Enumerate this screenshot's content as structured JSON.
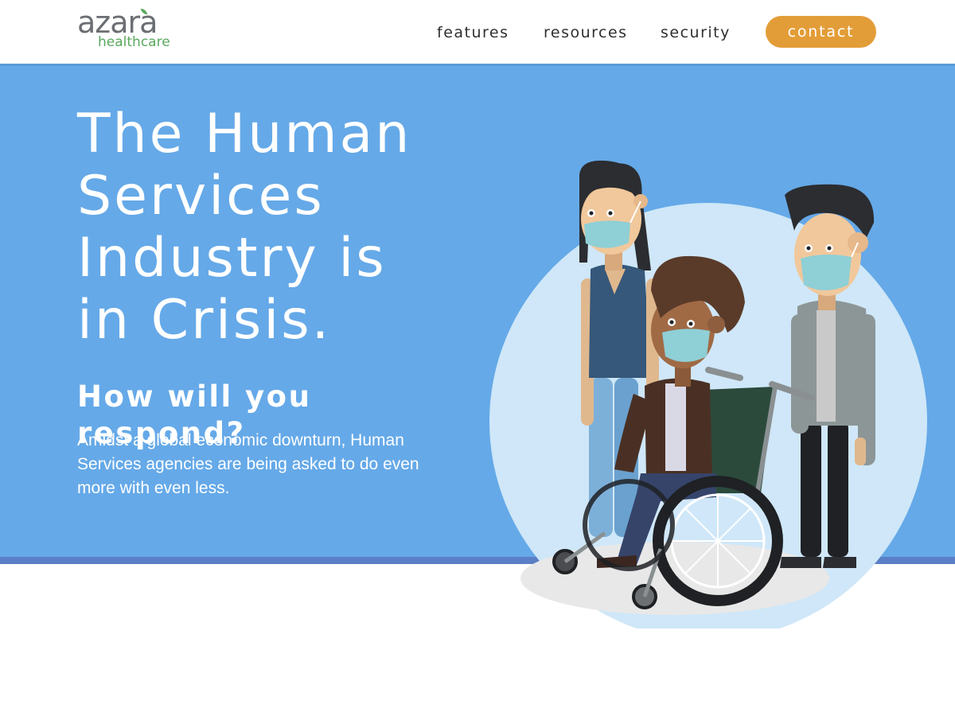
{
  "brand": {
    "name_main": "azara",
    "name_sub": "healthcare"
  },
  "nav": {
    "items": [
      {
        "label": "features"
      },
      {
        "label": "resources"
      },
      {
        "label": "security"
      }
    ],
    "contact_label": "contact"
  },
  "hero": {
    "headline_lines": [
      "The Human",
      "Services",
      "Industry is",
      "in Crisis."
    ],
    "subheadline": "How will you respond?",
    "body": "Amidst a global economic downturn, Human Services agencies are being asked to do even more with even less."
  },
  "colors": {
    "hero_background": "#65a9e8",
    "hero_bottom_bar": "#5b7fc6",
    "contact_button": "#e39d38",
    "brand_green": "#5aa85e",
    "brand_gray": "#6b6e72",
    "circle_backdrop": "#cfe7f8"
  },
  "illustration": {
    "icon": "masked-people-wheelchair-illustration"
  }
}
